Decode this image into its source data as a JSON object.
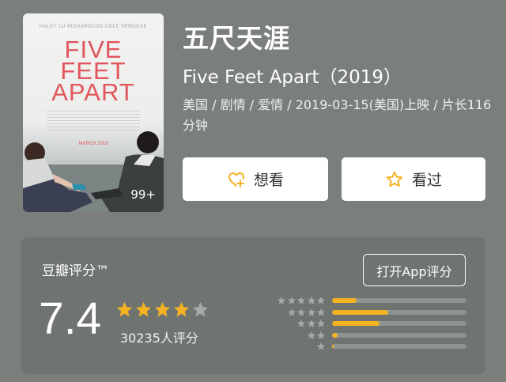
{
  "movie": {
    "title": "五尺天涯",
    "subtitle": "Five Feet Apart（2019）",
    "meta": "美国 / 剧情 / 爱情 / 2019-03-15(美国)上映 / 片长116分钟",
    "poster": {
      "credits": "HALEY LU RICHARDSON   COLE SPROUSE",
      "title_lines": [
        "FIVE",
        "FEET",
        "APART"
      ],
      "date": "MARCH 2019",
      "count": "99+"
    }
  },
  "actions": {
    "want_label": "想看",
    "seen_label": "看过"
  },
  "rating": {
    "label": "豆瓣评分™",
    "app_button": "打开App评分",
    "score": "7.4",
    "stars_filled": 4,
    "stars_total": 5,
    "votes": "30235人评分",
    "distribution": [
      {
        "stars": 5,
        "fraction": 0.18
      },
      {
        "stars": 4,
        "fraction": 0.42
      },
      {
        "stars": 3,
        "fraction": 0.35
      },
      {
        "stars": 2,
        "fraction": 0.04
      },
      {
        "stars": 1,
        "fraction": 0.01
      }
    ]
  },
  "colors": {
    "background": "#7a7f7b",
    "card": "#6f7470",
    "star": "#f5b324",
    "star_empty": "#a6aaa7",
    "poster_title": "#e0565c"
  }
}
